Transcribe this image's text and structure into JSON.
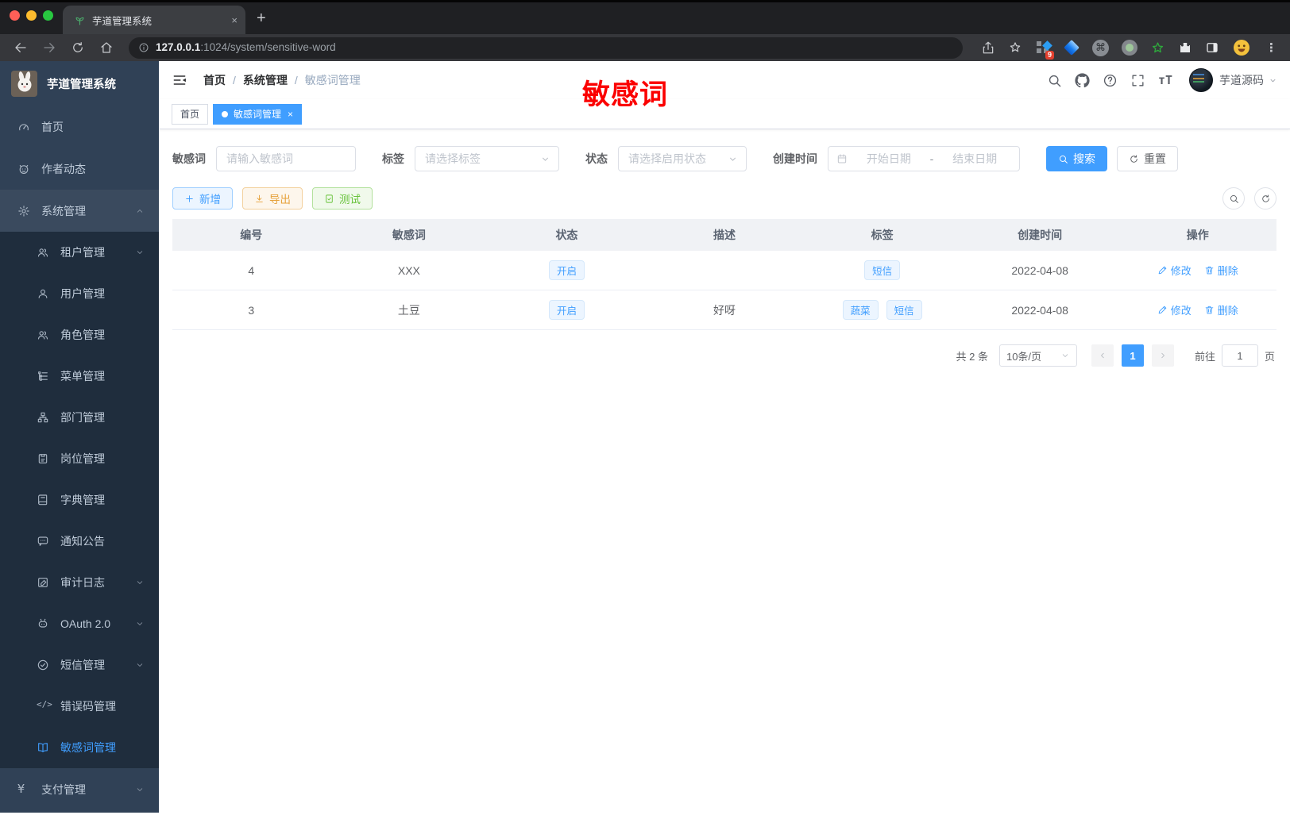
{
  "browser": {
    "tab_title": "芋道管理系统",
    "url_host": "127.0.0.1",
    "url_rest": ":1024/system/sensitive-word",
    "extension_badge": "9",
    "new_tab_glyph": "+",
    "close_glyph": "×"
  },
  "annotation": {
    "text": "敏感词"
  },
  "sidebar": {
    "title": "芋道管理系统",
    "items_top": [
      {
        "label": "首页"
      },
      {
        "label": "作者动态"
      }
    ],
    "group_label": "系统管理",
    "sub_items": [
      {
        "label": "租户管理"
      },
      {
        "label": "用户管理"
      },
      {
        "label": "角色管理"
      },
      {
        "label": "菜单管理"
      },
      {
        "label": "部门管理"
      },
      {
        "label": "岗位管理"
      },
      {
        "label": "字典管理"
      },
      {
        "label": "通知公告"
      },
      {
        "label": "审计日志"
      },
      {
        "label": "OAuth 2.0"
      },
      {
        "label": "短信管理"
      },
      {
        "label": "错误码管理"
      },
      {
        "label": "敏感词管理"
      }
    ],
    "bottom_label": "支付管理"
  },
  "header": {
    "breadcrumb": [
      "首页",
      "系统管理",
      "敏感词管理"
    ],
    "separator": "/",
    "username": "芋道源码"
  },
  "tabs": [
    {
      "label": "首页"
    },
    {
      "label": "敏感词管理"
    }
  ],
  "filters": {
    "keyword_label": "敏感词",
    "keyword_placeholder": "请输入敏感词",
    "tag_label": "标签",
    "tag_placeholder": "请选择标签",
    "status_label": "状态",
    "status_placeholder": "请选择启用状态",
    "date_label": "创建时间",
    "date_start_placeholder": "开始日期",
    "date_separator": "-",
    "date_end_placeholder": "结束日期",
    "search_label": "搜索",
    "reset_label": "重置"
  },
  "toolbar": {
    "add": "新增",
    "export": "导出",
    "test": "测试"
  },
  "table": {
    "columns": [
      "编号",
      "敏感词",
      "状态",
      "描述",
      "标签",
      "创建时间",
      "操作"
    ],
    "rows": [
      {
        "id": "4",
        "word": "XXX",
        "status": "开启",
        "desc": "",
        "tags": [
          "短信"
        ],
        "created": "2022-04-08"
      },
      {
        "id": "3",
        "word": "土豆",
        "status": "开启",
        "desc": "好呀",
        "tags": [
          "蔬菜",
          "短信"
        ],
        "created": "2022-04-08"
      }
    ],
    "edit_label": "修改",
    "delete_label": "删除"
  },
  "pagination": {
    "total": "共 2 条",
    "page_size": "10条/页",
    "page": "1",
    "goto": "前往",
    "goto_value": "1",
    "unit": "页"
  },
  "colors": {
    "accent": "#409eff",
    "warning": "#e6a23c",
    "success": "#67c23a",
    "annotation_red": "#fb0000"
  }
}
